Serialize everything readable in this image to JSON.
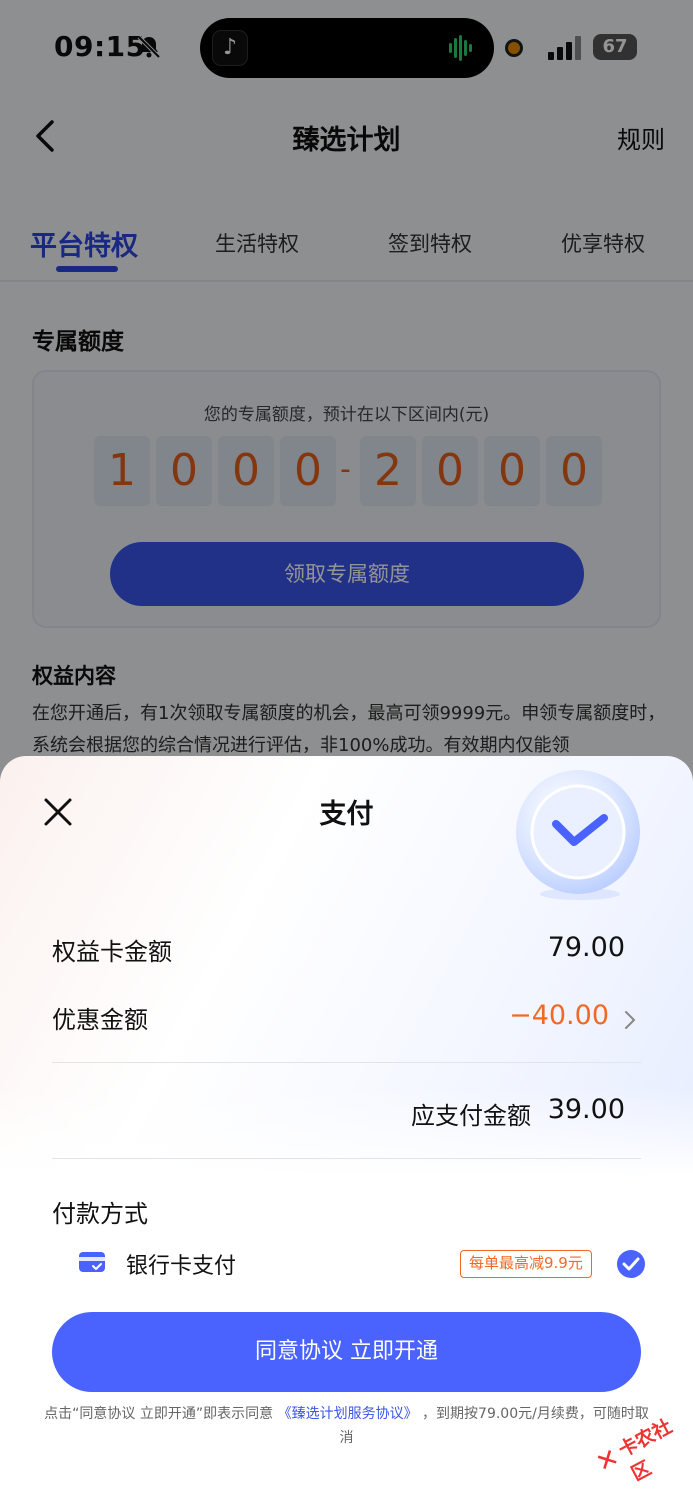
{
  "status_bar": {
    "time": "09:15",
    "battery": "67"
  },
  "nav": {
    "title": "臻选计划",
    "rule_link": "规则"
  },
  "tabs": [
    {
      "label": "平台特权",
      "active": true
    },
    {
      "label": "生活特权",
      "active": false
    },
    {
      "label": "签到特权",
      "active": false
    },
    {
      "label": "优享特权",
      "active": false
    }
  ],
  "quota": {
    "section_title": "专属额度",
    "caption": "您的专属额度，预计在以下区间内(元)",
    "digits_low": [
      "1",
      "0",
      "0",
      "0"
    ],
    "separator": "-",
    "digits_high": [
      "2",
      "0",
      "0",
      "0"
    ],
    "button_label": "领取专属额度"
  },
  "benefits": {
    "title": "权益内容",
    "text": "在您开通后，有1次领取专属额度的机会，最高可领9999元。申领专属额度时，系统会根据您的综合情况进行评估，非100%成功。有效期内仅能领"
  },
  "payment_sheet": {
    "title": "支付",
    "card_amount_label": "权益卡金额",
    "card_amount_value": "79.00",
    "discount_label": "优惠金额",
    "discount_value": "−40.00",
    "due_label": "应支付金额",
    "due_value": "39.00",
    "pay_method_title": "付款方式",
    "pay_method_name": "银行卡支付",
    "promo_tag": "每单最高减9.9元",
    "cta_label": "同意协议 立即开通",
    "agreement_prefix": "点击“同意协议 立即开通”即表示同意",
    "agreement_link": "《臻选计划服务协议》",
    "agreement_suffix": "，到期按79.00元/月续费，可随时取消"
  },
  "watermark": {
    "text": "卡农社区"
  },
  "colors": {
    "accent": "#4a63ff",
    "tab_active": "#2b48e0",
    "discount": "#f06a26"
  }
}
